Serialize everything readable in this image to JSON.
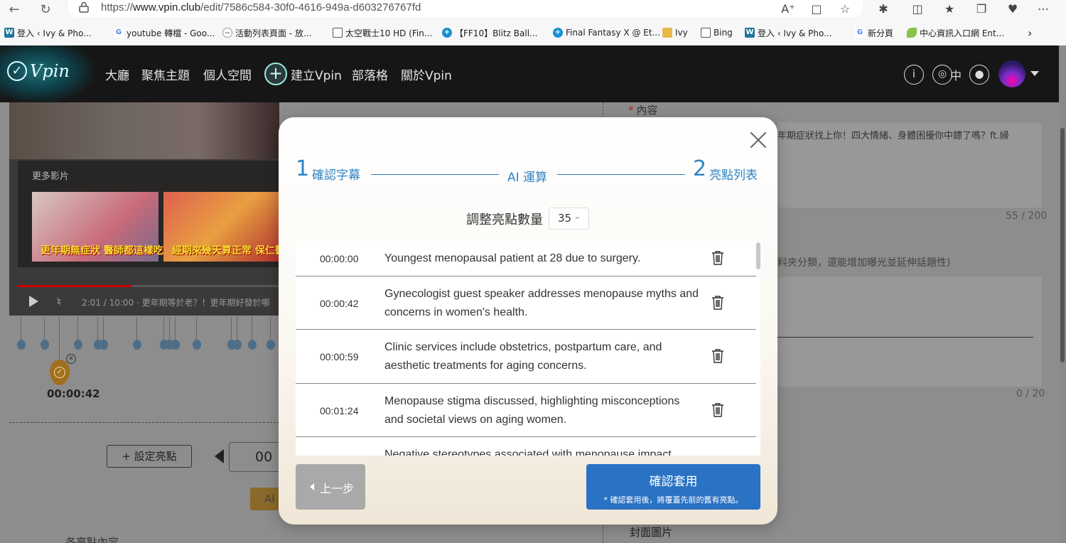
{
  "browser": {
    "url_prefix": "https://",
    "url_host": "www.vpin.club",
    "url_path": "/edit/7586c584-30f0-4616-949a-d603276767fd",
    "bookmarks": [
      {
        "label": "登入 ‹ Ivy & Pho...",
        "icon": "wordpress-icon"
      },
      {
        "label": "youtube 轉檔 - Goo...",
        "icon": "google-icon"
      },
      {
        "label": "活動列表頁面 - 放...",
        "icon": "site-icon"
      },
      {
        "label": "太空戰士10 HD (Fin...",
        "icon": "page-icon"
      },
      {
        "label": "【FF10】Blitz Ball...",
        "icon": "ff-icon"
      },
      {
        "label": "Final Fantasy X @ Et...",
        "icon": "ff-icon"
      },
      {
        "label": "Ivy",
        "icon": "folder-icon"
      },
      {
        "label": "Bing",
        "icon": "page-icon"
      },
      {
        "label": "登入 ‹ Ivy & Pho...",
        "icon": "wordpress-icon"
      },
      {
        "label": "新分頁",
        "icon": "google-icon"
      },
      {
        "label": "中心資訊入口網 Ent...",
        "icon": "leaf-icon"
      }
    ]
  },
  "header": {
    "logo_text": "Vpin",
    "nav": [
      "大廳",
      "聚焦主題",
      "個人空間",
      "建立Vpin",
      "部落格",
      "關於Vpin"
    ],
    "lang": "中"
  },
  "page": {
    "more_videos": "更多影片",
    "thumb1_caption": "更年期無症狀 醫師都這樣吃!",
    "thumb2_caption": "經期來幾天算正常 保仁醫師報你知",
    "video_time": "2:01 / 10:00 · 更年期等於老？！更年期好發於哪",
    "selected_time": "00:00:42",
    "set_highlight": "設定亮點",
    "time_box": "00",
    "ai_btn": "AI",
    "bottom_left": "各亮點內容",
    "content_label": "內容",
    "content_text": "年期症狀找上你！四大情緒、身體困擾你中鏢了嗎？ft.婦",
    "content_count": "55 / 200",
    "hint": "料夾分類，還能增加曝光並延伸話題性)",
    "tag_count": "0 / 20",
    "cover_label": "封面圖片"
  },
  "modal": {
    "step1_num": "1",
    "step1_label": "確認字幕",
    "middle_label": "AI 運算",
    "step2_num": "2",
    "step2_label": "亮點列表",
    "count_label": "調整亮點數量",
    "count_value": "35",
    "rows": [
      {
        "time": "00:00:00",
        "text": "Youngest menopausal patient at 28 due to surgery."
      },
      {
        "time": "00:00:42",
        "text": "Gynecologist guest speaker addresses menopause myths and concerns in women's health."
      },
      {
        "time": "00:00:59",
        "text": "Clinic services include obstetrics, postpartum care, and aesthetic treatments for aging concerns."
      },
      {
        "time": "00:01:24",
        "text": "Menopause stigma discussed, highlighting misconceptions and societal views on aging women."
      },
      {
        "time": "",
        "text": "Negative stereotypes associated with menopause impact"
      }
    ],
    "back_label": "上一步",
    "confirm_label": "確認套用",
    "confirm_note": "* 確認套用後，將覆蓋先前的舊有亮點。"
  }
}
